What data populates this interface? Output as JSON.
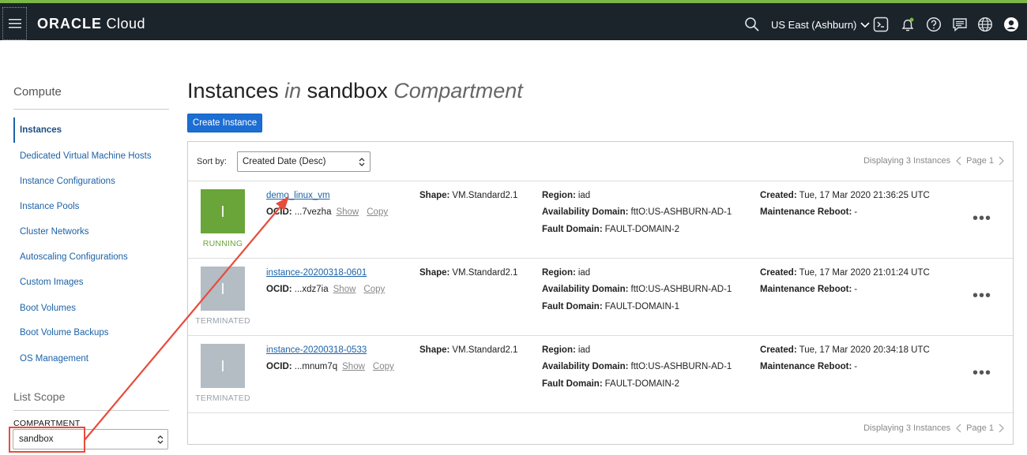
{
  "header": {
    "brand": "ORACLE",
    "product": "Cloud",
    "region": "US East (Ashburn)"
  },
  "sidebar": {
    "title": "Compute",
    "items": [
      {
        "label": "Instances",
        "active": true
      },
      {
        "label": "Dedicated Virtual Machine Hosts"
      },
      {
        "label": "Instance Configurations"
      },
      {
        "label": "Instance Pools"
      },
      {
        "label": "Cluster Networks"
      },
      {
        "label": "Autoscaling Configurations"
      },
      {
        "label": "Custom Images"
      },
      {
        "label": "Boot Volumes"
      },
      {
        "label": "Boot Volume Backups"
      },
      {
        "label": "OS Management"
      }
    ],
    "scope_title": "List Scope",
    "compartment_label": "COMPARTMENT",
    "compartment_value": "sandbox"
  },
  "main": {
    "title_main": "Instances",
    "title_in": "in",
    "title_comp": "sandbox",
    "title_suffix": "Compartment",
    "create_button": "Create Instance",
    "sort_label": "Sort by:",
    "sort_value": "Created Date (Desc)",
    "pager_text": "Displaying 3 Instances",
    "pager_page": "Page 1",
    "labels": {
      "ocid": "OCID:",
      "show": "Show",
      "copy": "Copy",
      "shape": "Shape:",
      "region": "Region:",
      "ad": "Availability Domain:",
      "fd": "Fault Domain:",
      "created": "Created:",
      "maint": "Maintenance Reboot:"
    },
    "instances": [
      {
        "name": "demo_linux_vm",
        "status": "RUNNING",
        "ocid": "...7vezha",
        "shape": "VM.Standard2.1",
        "region": "iad",
        "ad": "fttO:US-ASHBURN-AD-1",
        "fd": "FAULT-DOMAIN-2",
        "created": "Tue, 17 Mar 2020 21:36:25 UTC",
        "maint": "-"
      },
      {
        "name": "instance-20200318-0601",
        "status": "TERMINATED",
        "ocid": "...xdz7ia",
        "shape": "VM.Standard2.1",
        "region": "iad",
        "ad": "fttO:US-ASHBURN-AD-1",
        "fd": "FAULT-DOMAIN-1",
        "created": "Tue, 17 Mar 2020 21:01:24 UTC",
        "maint": "-"
      },
      {
        "name": "instance-20200318-0533",
        "status": "TERMINATED",
        "ocid": "...mnum7q",
        "shape": "VM.Standard2.1",
        "region": "iad",
        "ad": "fttO:US-ASHBURN-AD-1",
        "fd": "FAULT-DOMAIN-2",
        "created": "Tue, 17 Mar 2020 20:34:18 UTC",
        "maint": "-"
      }
    ]
  },
  "colors": {
    "header_bg": "#1b232b",
    "accent_blue": "#1c6ed4",
    "running_green": "#6aa539",
    "terminated_gray": "#b4bcc4",
    "annotation_red": "#e74c3c"
  },
  "icons": [
    "menu-icon",
    "search-icon",
    "chevron-down-icon",
    "cloud-shell-icon",
    "bell-icon",
    "help-icon",
    "chat-icon",
    "globe-icon",
    "user-icon",
    "select-arrows-icon",
    "chevron-left-icon",
    "chevron-right-icon",
    "more-actions-icon"
  ]
}
